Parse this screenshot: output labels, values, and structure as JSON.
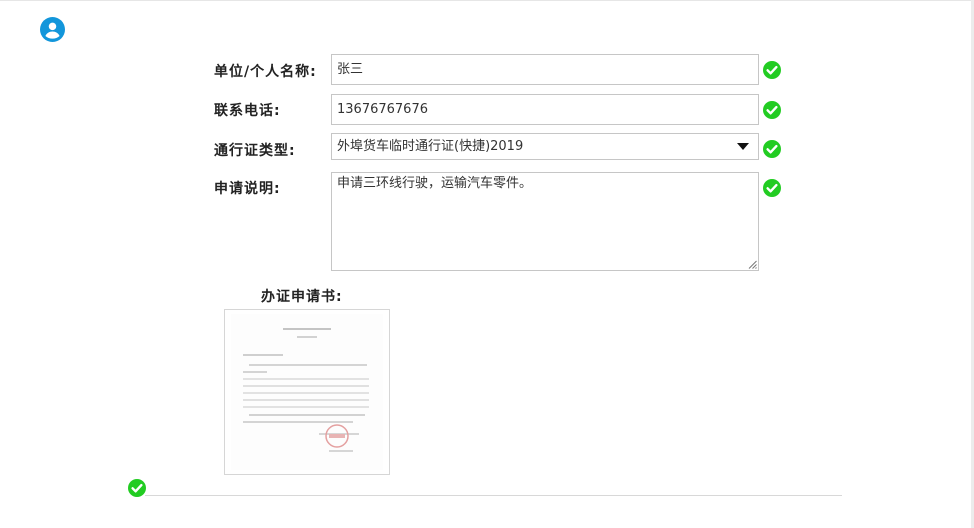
{
  "form": {
    "name_label": "单位/个人名称:",
    "name_value": "张三",
    "phone_label": "联系电话:",
    "phone_value": "13676767676",
    "type_label": "通行证类型:",
    "type_selected": "外埠货车临时通行证(快捷)2019",
    "desc_label": "申请说明:",
    "desc_value": "申请三环线行驶，运输汽车零件。",
    "doc_label": "办证申请书:"
  },
  "colors": {
    "valid": "#22cc22",
    "user_icon": "#1296db"
  },
  "icons": {
    "user": "user-circle-icon",
    "valid": "check-circle-icon",
    "dropdown": "caret-down-icon"
  }
}
